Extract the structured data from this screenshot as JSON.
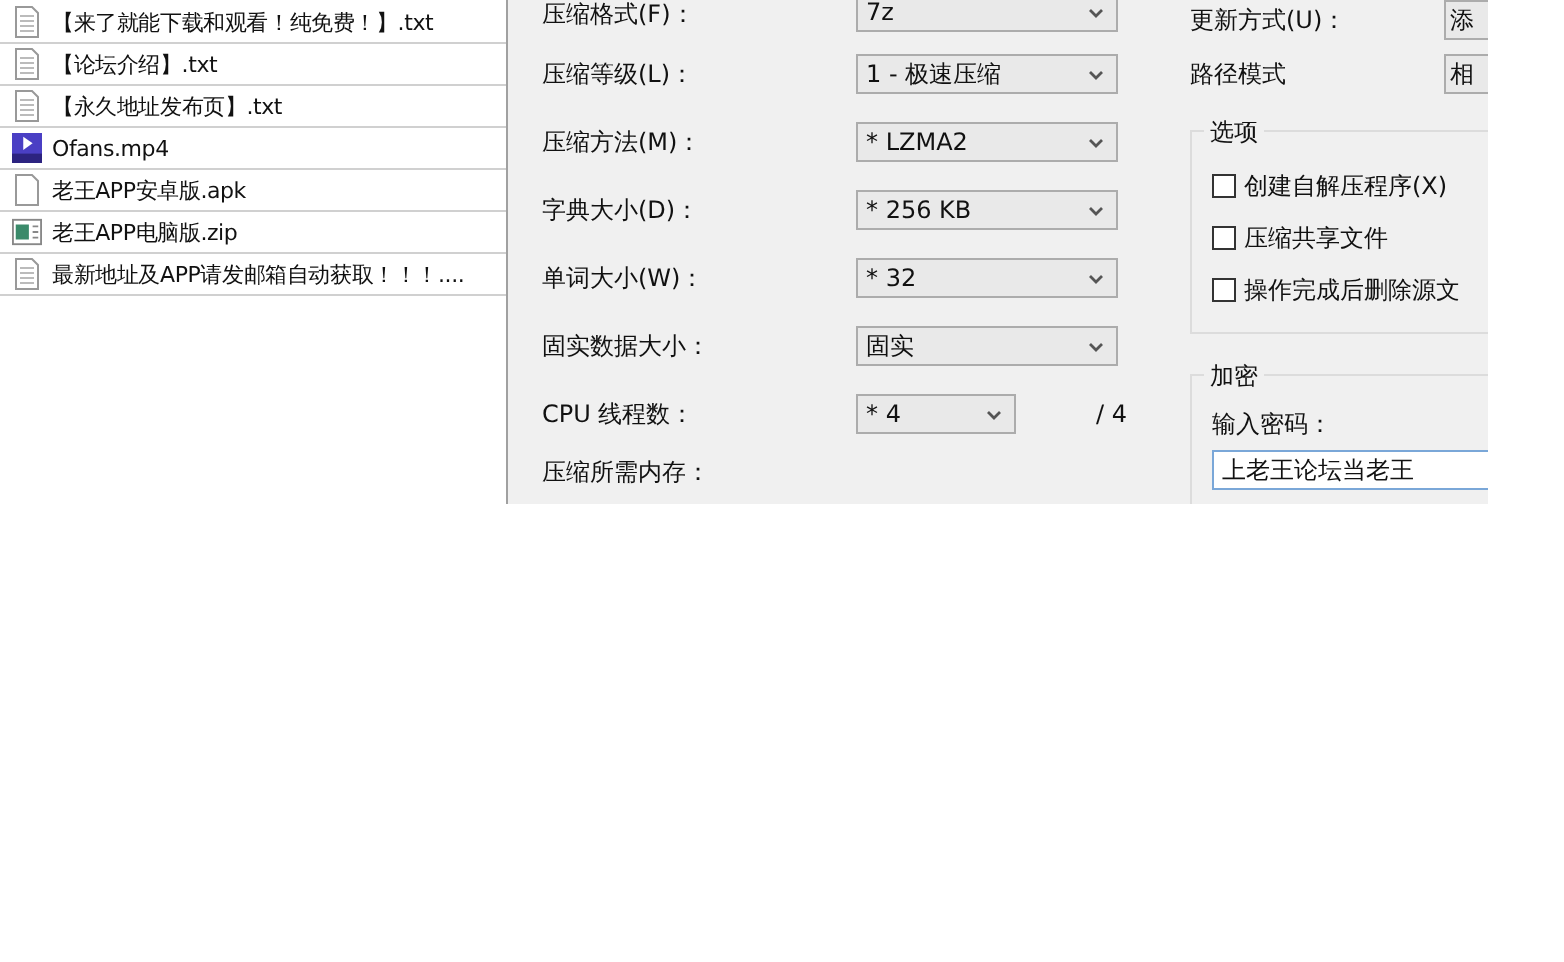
{
  "file_list": [
    {
      "name": "【来了就能下载和观看！纯免费！】.txt",
      "kind": "text"
    },
    {
      "name": "【论坛介绍】.txt",
      "kind": "text"
    },
    {
      "name": "【永久地址发布页】.txt",
      "kind": "text"
    },
    {
      "name": "Ofans.mp4",
      "kind": "video"
    },
    {
      "name": "老王APP安卓版.apk",
      "kind": "blank"
    },
    {
      "name": "老王APP电脑版.zip",
      "kind": "archive"
    },
    {
      "name": "最新地址及APP请发邮箱自动获取！！！....",
      "kind": "text"
    }
  ],
  "compression": [
    {
      "label": "压缩格式(F)：",
      "value": "7z"
    },
    {
      "label": "压缩等级(L)：",
      "value": "1 - 极速压缩"
    },
    {
      "label": "压缩方法(M)：",
      "value": "* LZMA2"
    },
    {
      "label": "字典大小(D)：",
      "value": "* 256 KB"
    },
    {
      "label": "单词大小(W)：",
      "value": "* 32"
    },
    {
      "label": "固实数据大小：",
      "value": "固实"
    }
  ],
  "cpu_threads": {
    "label": "CPU 线程数：",
    "value": "* 4",
    "max": "/ 4"
  },
  "memory_label": "压缩所需内存：",
  "update_mode": {
    "label": "更新方式(U)：",
    "value": "添"
  },
  "path_mode": {
    "label": "路径模式",
    "value": "相"
  },
  "options": {
    "title": "选项",
    "items": [
      {
        "label": "创建自解压程序(X)",
        "checked": false
      },
      {
        "label": "压缩共享文件",
        "checked": false
      },
      {
        "label": "操作完成后删除源文",
        "checked": false
      }
    ]
  },
  "encryption": {
    "title": "加密",
    "password_label": "输入密码：",
    "password": "上老王论坛当老王"
  }
}
